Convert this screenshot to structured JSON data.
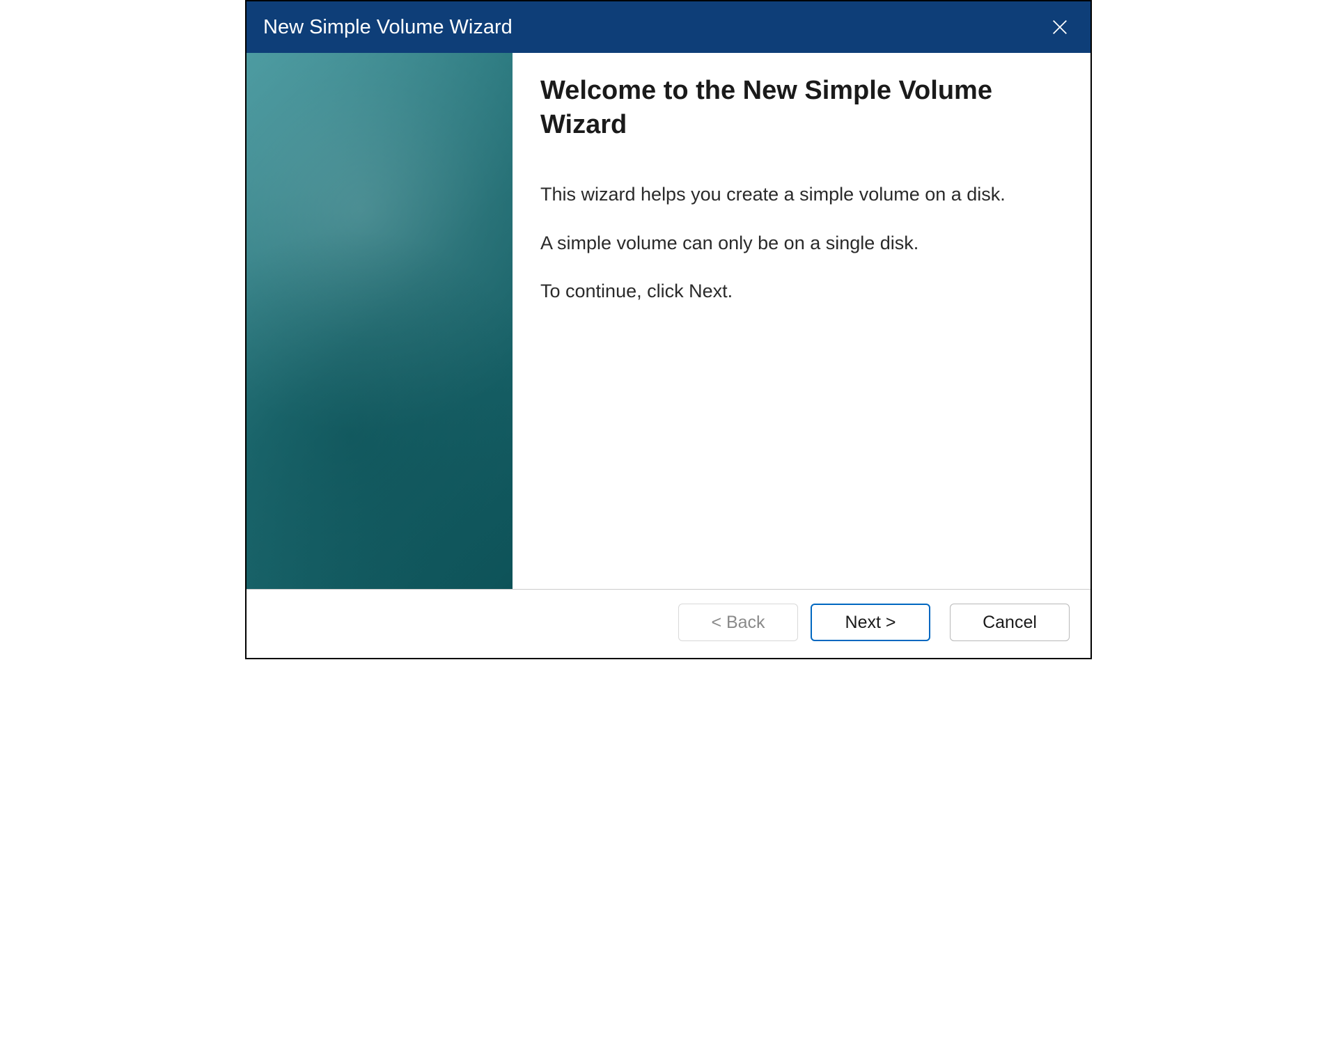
{
  "titlebar": {
    "title": "New Simple Volume Wizard"
  },
  "content": {
    "heading": "Welcome to the New Simple Volume Wizard",
    "paragraph1": "This wizard helps you create a simple volume on a disk.",
    "paragraph2": "A simple volume can only be on a single disk.",
    "paragraph3": "To continue, click Next."
  },
  "buttons": {
    "back": "< Back",
    "next": "Next >",
    "cancel": "Cancel"
  }
}
